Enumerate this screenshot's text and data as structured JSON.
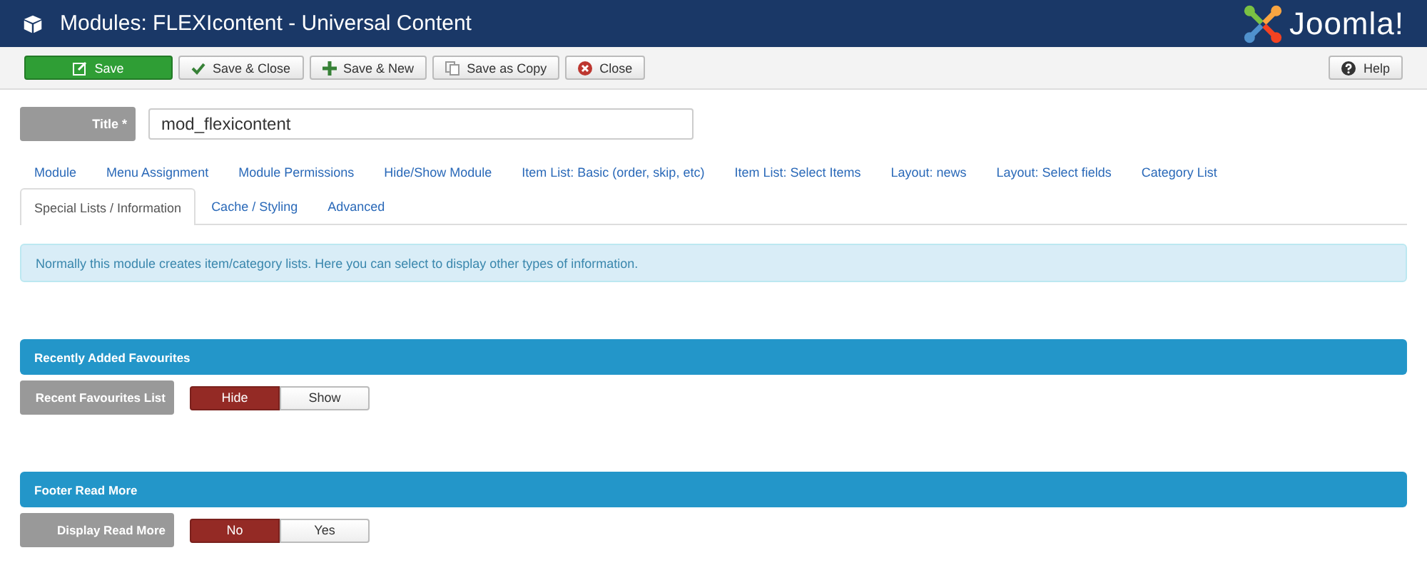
{
  "header": {
    "title": "Modules: FLEXIcontent - Universal Content",
    "logo_text": "Joomla!"
  },
  "toolbar": [
    {
      "kind": "save",
      "label": "Save"
    },
    {
      "kind": "check",
      "label": "Save & Close"
    },
    {
      "kind": "plus",
      "label": "Save & New"
    },
    {
      "kind": "copy",
      "label": "Save as Copy"
    },
    {
      "kind": "close",
      "label": "Close"
    },
    {
      "kind": "help",
      "label": "Help"
    }
  ],
  "title_field": {
    "label": "Title *",
    "value": "mod_flexicontent"
  },
  "tabs": [
    [
      {
        "label": "Module",
        "selected": false
      },
      {
        "label": "Menu Assignment",
        "selected": false
      },
      {
        "label": "Module Permissions",
        "selected": false
      },
      {
        "label": "Hide/Show Module",
        "selected": false
      },
      {
        "label": "Item List: Basic (order, skip, etc)",
        "selected": false
      },
      {
        "label": "Item List: Select Items",
        "selected": false
      },
      {
        "label": "Layout: news",
        "selected": false
      },
      {
        "label": "Layout: Select fields",
        "selected": false
      },
      {
        "label": "Category List",
        "selected": false
      }
    ],
    [
      {
        "label": "Special Lists / Information",
        "selected": true
      },
      {
        "label": "Cache / Styling",
        "selected": false
      },
      {
        "label": "Advanced",
        "selected": false
      }
    ]
  ],
  "info": "Normally this module creates item/category lists. Here you can select to display other types of information.",
  "sections": [
    {
      "title": "Recently Added Favourites",
      "fields": [
        {
          "label": "Recent Favourites List",
          "options": [
            {
              "label": "Hide",
              "selected": true
            },
            {
              "label": "Show",
              "selected": false
            }
          ]
        }
      ]
    },
    {
      "title": "Footer Read More",
      "fields": [
        {
          "label": "Display Read More",
          "options": [
            {
              "label": "No",
              "selected": true
            },
            {
              "label": "Yes",
              "selected": false
            }
          ]
        }
      ]
    }
  ]
}
